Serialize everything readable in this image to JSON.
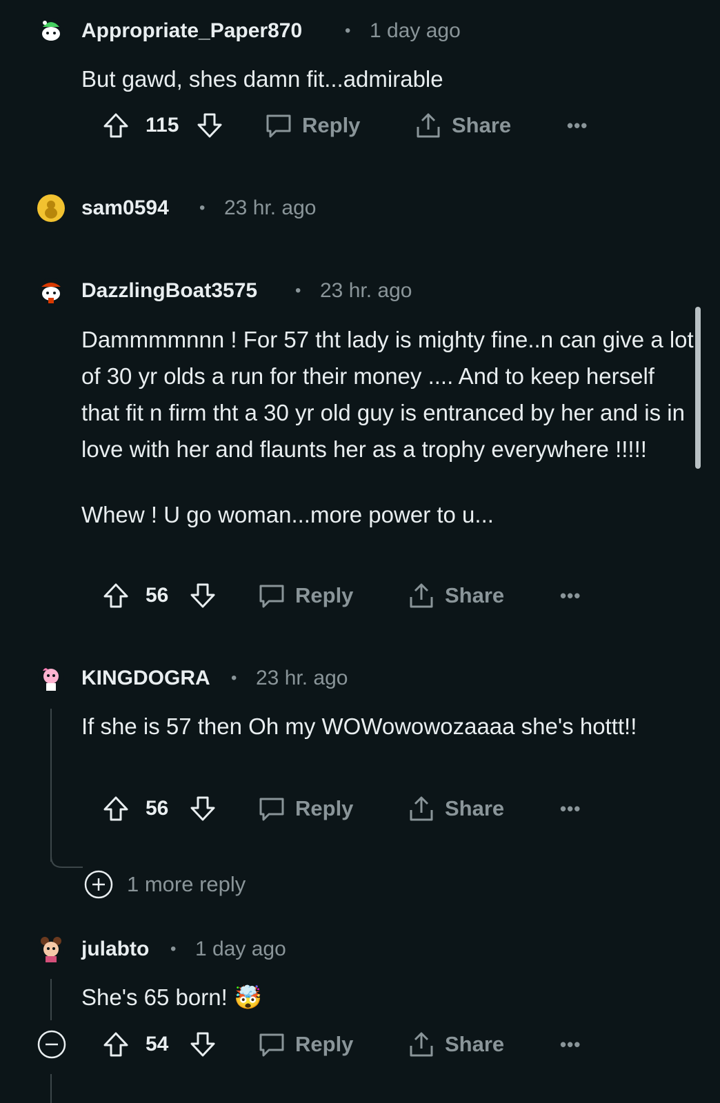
{
  "colors": {
    "background": "#0c1518",
    "text_primary": "#e9eef0",
    "text_secondary": "#8a9599",
    "thread_line": "#3c4649"
  },
  "comments": [
    {
      "username": "Appropriate_Paper870",
      "time": "1 day ago",
      "body": [
        "But gawd, shes damn fit...admirable"
      ],
      "votes": "115",
      "reply_label": "Reply",
      "share_label": "Share",
      "more_label": "•••"
    },
    {
      "username": "sam0594",
      "time": "23 hr. ago",
      "body": []
    },
    {
      "username": "DazzlingBoat3575",
      "time": "23 hr. ago",
      "body": [
        "Dammmmnnn ! For 57 tht lady is mighty fine..n can give a lot of 30 yr olds a run for their money .... And to keep herself that fit n firm tht a 30 yr old guy is entranced by her and is in love with her and flaunts her as a trophy everywhere !!!!!",
        "Whew ! U go woman...more power to u..."
      ],
      "votes": "56",
      "reply_label": "Reply",
      "share_label": "Share",
      "more_label": "•••"
    },
    {
      "username": "KINGDOGRA",
      "time": "23 hr. ago",
      "body": [
        "If she is 57 then Oh my WOWowowozaaaa she's hottt!!"
      ],
      "votes": "56",
      "reply_label": "Reply",
      "share_label": "Share",
      "more_label": "•••",
      "more_replies": "1 more reply"
    },
    {
      "username": "julabto",
      "time": "1 day ago",
      "body": [
        "She's 65 born! 🤯"
      ],
      "votes": "54",
      "reply_label": "Reply",
      "share_label": "Share",
      "more_label": "•••"
    }
  ],
  "separator": "•"
}
